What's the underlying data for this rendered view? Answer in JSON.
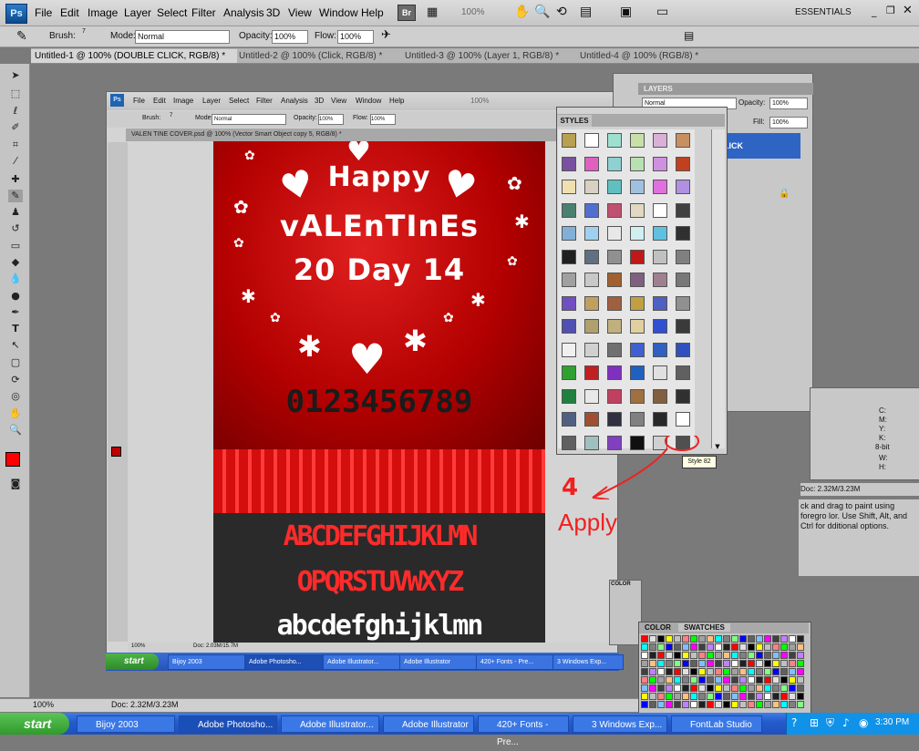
{
  "app": {
    "logo": "Ps",
    "menu": [
      "File",
      "Edit",
      "Image",
      "Layer",
      "Select",
      "Filter",
      "Analysis",
      "3D",
      "View",
      "Window",
      "Help"
    ],
    "zoom": "100%",
    "workspace": "ESSENTIALS",
    "bridge_btn": "Br"
  },
  "options_bar": {
    "brush_label": "Brush:",
    "brush_size": "7",
    "mode_label": "Mode:",
    "mode_value": "Normal",
    "opacity_label": "Opacity:",
    "opacity_value": "100%",
    "flow_label": "Flow:",
    "flow_value": "100%"
  },
  "doc_tabs": [
    "Untitled-1 @ 100% (DOUBLE CLICK, RGB/8) *",
    "Untitled-2 @ 100% (Click, RGB/8) *",
    "Untitled-3 @ 100% (Layer 1, RGB/8) *",
    "Untitled-4 @ 100% (RGB/8) *"
  ],
  "inner": {
    "menu": [
      "File",
      "Edit",
      "Image",
      "Layer",
      "Select",
      "Filter",
      "Analysis",
      "3D",
      "View",
      "Window",
      "Help"
    ],
    "zoom": "100%",
    "brush_label": "Brush:",
    "brush_size": "7",
    "mode_label": "Mode:",
    "mode_value": "Normal",
    "opacity_label": "Opacity:",
    "opacity_value": "100%",
    "flow_label": "Flow:",
    "flow_value": "100%",
    "doc_tab": "VALEN TINE COVER.psd @ 100% (Vector Smart Object copy 5, RGB/8) *",
    "status_zoom": "100%",
    "status_doc": "Doc: 2.03M/15.7M",
    "canvas": {
      "line1": "Happy",
      "line2": "vALEnTInEs",
      "line3": "20 Day 14",
      "digits": "0123456789",
      "upper1": "ABCDEFGHIJKLMN",
      "upper2": "OPQRSTUVWXYZ",
      "lower": "abcdefghijklmn"
    },
    "taskbar": {
      "start": "start",
      "items": [
        "Bijoy 2003",
        "Adobe Photosho...",
        "Adobe Illustrator...",
        "Adobe Illustrator",
        "420+ Fonts - Pre...",
        "3 Windows Exp..."
      ]
    }
  },
  "layers_panel": {
    "title": "LAYERS",
    "blend": "Normal",
    "opacity_label": "Opacity:",
    "opacity_value": "100%",
    "fill_label": "Fill:",
    "fill_value": "100%",
    "selected_layer": "LICK"
  },
  "styles_panel": {
    "title": "STYLES",
    "tooltip": "Style 82"
  },
  "annotation": {
    "number": "4",
    "label": "Apply"
  },
  "info_panel": {
    "labels": [
      "C:",
      "M:",
      "Y:",
      "K:",
      "8-bit",
      "W:",
      "H:"
    ]
  },
  "hint_text": "ck and drag to paint using foregro lor.  Use Shift, Alt, and Ctrl for dditional options.",
  "color_panel": {
    "title": "COLOR"
  },
  "swatches_panel": {
    "tab_color": "COLOR",
    "tab_swatches": "SWATCHES"
  },
  "status": {
    "zoom": "100%",
    "doc": "Doc: 2.32M/3.23M"
  },
  "taskbar": {
    "start": "start",
    "items": [
      "Bijoy 2003",
      "Adobe Photosho...",
      "Adobe Illustrator...",
      "Adobe Illustrator",
      "420+ Fonts - Pre...",
      "3 Windows Exp...",
      "FontLab Studio"
    ],
    "time": "3:30 PM",
    "colors": {
      "bar": "#245ccc",
      "start": "#2f9a2c",
      "tray": "#1092e8"
    }
  }
}
